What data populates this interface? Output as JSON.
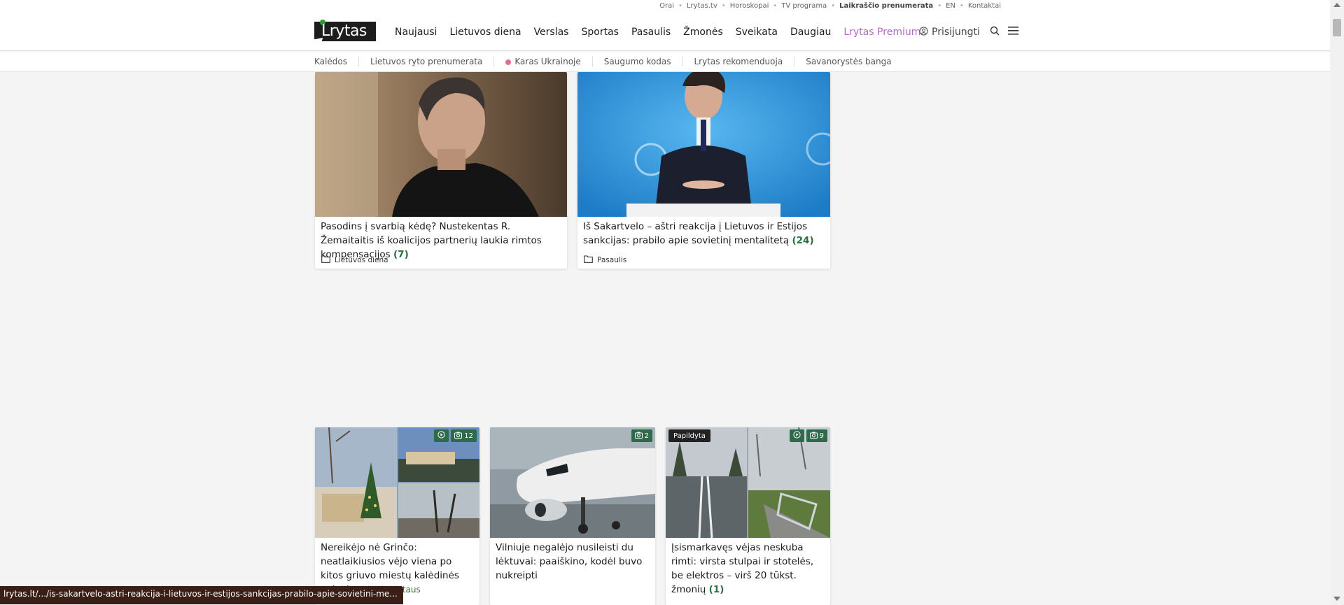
{
  "top_links": {
    "items": [
      "Orai",
      "Lrytas.tv",
      "Horoskopai",
      "TV programa",
      "Laikraščio prenumerata",
      "EN",
      "Kontaktai"
    ]
  },
  "header": {
    "logo_text": "Lrytas",
    "nav": [
      "Naujausi",
      "Lietuvos diena",
      "Verslas",
      "Sportas",
      "Pasaulis",
      "Žmonės",
      "Sveikata",
      "Daugiau",
      "Lrytas Premium"
    ],
    "login_label": "Prisijungti"
  },
  "subnav": {
    "items": [
      "Kalėdos",
      "Lietuvos ryto prenumerata",
      "Karas Ukrainoje",
      "Saugumo kodas",
      "Lrytas rekomenduoja",
      "Savanorystės banga"
    ]
  },
  "articles_top": [
    {
      "title": "Pasodins į svarbią kėdę? Nustekentas R. Žemaitaitis iš koalicijos partnerių laukia rimtos kompensacijos",
      "comments": "(7)",
      "category": "Lietuvos diena"
    },
    {
      "title": "Iš Sakartvelo – aštri reakcija į Lietuvos ir Estijos sankcijas: prabilo apie sovietinį mentalitetą",
      "comments": "(24)",
      "category": "Pasaulis"
    }
  ],
  "articles_bottom": [
    {
      "title": "Nereikėjo nė Grinčo: neatlaikiusios vėjo viena po kitos griuvo miestų kalėdinės eglutės",
      "sub": "Krito ir Alytaus",
      "photos": "12"
    },
    {
      "title": "Vilniuje negalėjo nusileisti du lėktuvai: paaiškino, kodėl buvo nukreipti",
      "photos": "2"
    },
    {
      "title": "Įsismarkavęs vėjas neskuba rimti: virsta stulpai ir stotelės, be elektros – virš 20 tūkst. žmonių",
      "comments": "(1)",
      "tag": "Papildyta",
      "photos": "9"
    }
  ],
  "status_url": "lrytas.lt/.../is-sakartvelo-astri-reakcija-i-lietuvos-ir-estijos-sankcijas-prabilo-apie-sovietini-me...",
  "colors": {
    "accent_green": "#2e6b4a",
    "premium": "#b06ac7"
  }
}
